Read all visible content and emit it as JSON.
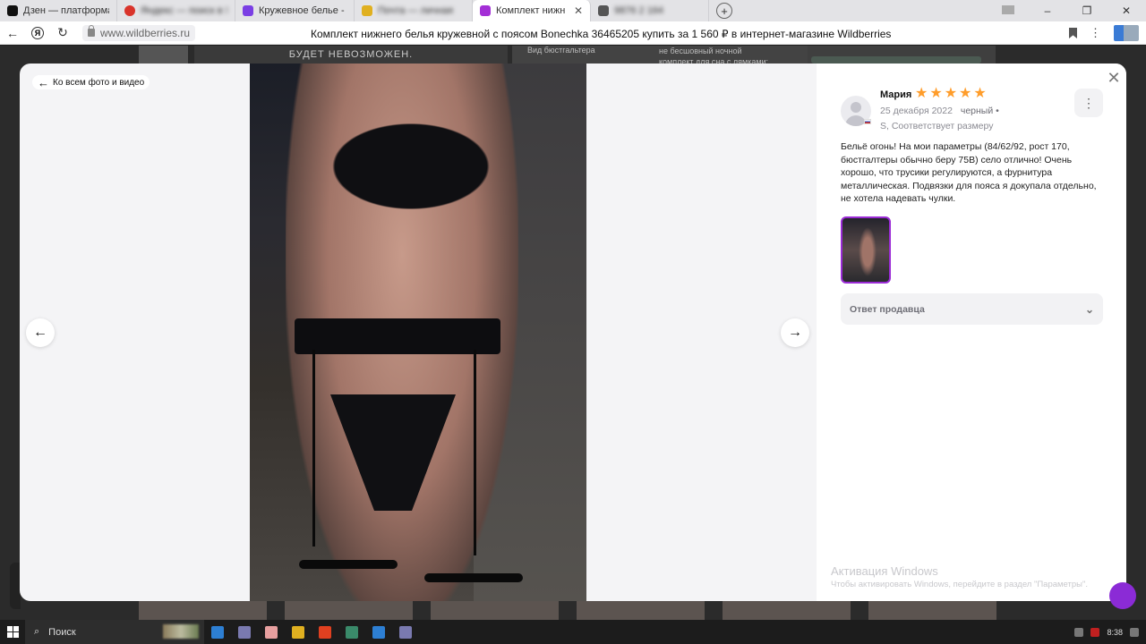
{
  "browser": {
    "tabs": [
      {
        "label": "Дзен — платформа для п",
        "favicon_color": "#111111",
        "blurred": false,
        "active": false
      },
      {
        "label": "Яндекс — поиск в Яндекс",
        "favicon_color": "#d9342b",
        "blurred": true,
        "active": false
      },
      {
        "label": "Кружевное белье - Анон",
        "favicon_color": "#7b3fe4",
        "blurred": false,
        "active": false
      },
      {
        "label": "Почта — личная",
        "favicon_color": "#e0b020",
        "blurred": true,
        "active": false
      },
      {
        "label": "Комплект нижнего бел",
        "favicon_color": "#a32fd6",
        "blurred": false,
        "active": true
      },
      {
        "label": "9876 2 164",
        "favicon_color": "#555555",
        "blurred": true,
        "active": false
      }
    ],
    "new_tab_symbol": "+",
    "url": "www.wildberries.ru",
    "page_title": "Комплект нижнего белья кружевной с поясом Bonechka 36465205 купить за 1 560 ₽ в интернет-магазине Wildberries"
  },
  "background_page": {
    "banner_text": "БУДЕТ НЕВОЗМОЖЕН.",
    "spec_key": "Вид бюстгальтера",
    "spec_value_line1": "не бесшовный ночной",
    "spec_value_line2": "комплект для сна с лямками;..."
  },
  "modal": {
    "back_link": "Ко всем фото и видео",
    "prev_symbol": "←",
    "next_symbol": "→",
    "close_symbol": "✕",
    "review": {
      "author": "Мария",
      "rating": 5,
      "rating_max": 5,
      "date": "25 декабря 2022",
      "color": "черный •",
      "size_fit": "S, Соответствует размеру",
      "text": "Бельё огонь! На мои параметры (84/62/92, рост 170, бюстгалтеры обычно беру 75B) село отлично! Очень хорошо, что трусики регулируются, а фурнитура металлическая. Подвязки для пояса я докупала отдельно, не хотела надевать чулки.",
      "more_symbol": "⋮"
    },
    "seller_answer_label": "Ответ продавца",
    "accent_color": "#9b2bd6",
    "star_color": "#ff9d2b"
  },
  "watermark": {
    "title": "Активация Windows",
    "subtitle": "Чтобы активировать Windows, перейдите в раздел \"Параметры\"."
  },
  "taskbar": {
    "search_label": "Поиск",
    "clock": "8:38",
    "app_icon_colors": [
      "#2d7fd3",
      "#7a7ab0",
      "#e8a0a0",
      "#e0b020",
      "#e04020",
      "#3a8a6a",
      "#2d7fd3",
      "#7a7ab0"
    ]
  }
}
